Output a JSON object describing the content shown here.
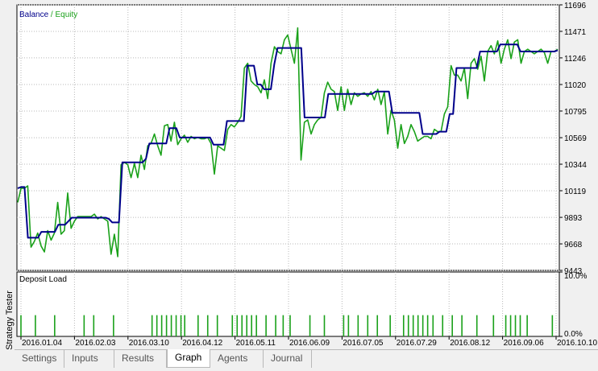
{
  "side_label": "Strategy Tester",
  "tabs": [
    {
      "label": "Settings",
      "active": false
    },
    {
      "label": "Inputs",
      "active": false
    },
    {
      "label": "Results",
      "active": false
    },
    {
      "label": "Graph",
      "active": true
    },
    {
      "label": "Agents",
      "active": false
    },
    {
      "label": "Journal",
      "active": false
    }
  ],
  "colors": {
    "balance": "#00008b",
    "equity": "#1aa11a",
    "load": "#1aa11a",
    "grid": "#b8b8b8",
    "border": "#000000"
  },
  "chart_data": [
    {
      "type": "line",
      "legend": {
        "balance": "Balance",
        "separator": " / ",
        "equity": "Equity",
        "placement": "top-left"
      },
      "x_tick_labels": [
        "2016.01.04",
        "2016.02.03",
        "2016.03.10",
        "2016.04.12",
        "2016.05.11",
        "2016.06.09",
        "2016.07.05",
        "2016.07.29",
        "2016.08.12",
        "2016.09.06",
        "2016.10.10"
      ],
      "y_tick_labels": [
        "11696",
        "11471",
        "11246",
        "11020",
        "10795",
        "10569",
        "10344",
        "10119",
        "9893",
        "9668",
        "9443"
      ],
      "ylim": [
        9443,
        11696
      ],
      "grid": true,
      "series": [
        {
          "name": "Balance",
          "values": [
            10140,
            10150,
            10150,
            9720,
            9720,
            9720,
            9720,
            9770,
            9770,
            9770,
            9770,
            9770,
            9830,
            9830,
            9830,
            9860,
            9890,
            9890,
            9890,
            9890,
            9890,
            9890,
            9890,
            9890,
            9890,
            9890,
            9890,
            9880,
            9850,
            9850,
            9850,
            10360,
            10360,
            10360,
            10360,
            10360,
            10360,
            10360,
            10390,
            10520,
            10520,
            10520,
            10520,
            10520,
            10520,
            10650,
            10650,
            10650,
            10570,
            10570,
            10570,
            10570,
            10570,
            10570,
            10570,
            10570,
            10570,
            10570,
            10510,
            10510,
            10510,
            10510,
            10710,
            10710,
            10710,
            10710,
            10710,
            10710,
            11180,
            11180,
            11180,
            11020,
            11020,
            10980,
            10980,
            10980,
            11190,
            11330,
            11330,
            11330,
            11330,
            11330,
            11330,
            11330,
            11330,
            10740,
            10740,
            10740,
            10740,
            10740,
            10740,
            10740,
            10940,
            10940,
            10940,
            10940,
            10940,
            10940,
            10940,
            10940,
            10940,
            10940,
            10940,
            10940,
            10940,
            10940,
            10960,
            10960,
            10960,
            10960,
            10960,
            10780,
            10780,
            10780,
            10780,
            10780,
            10780,
            10780,
            10780,
            10780,
            10600,
            10600,
            10600,
            10600,
            10600,
            10620,
            10620,
            10620,
            10770,
            10770,
            11160,
            11160,
            11160,
            11160,
            11160,
            11160,
            11160,
            11300,
            11300,
            11300,
            11300,
            11300,
            11300,
            11360,
            11360,
            11360,
            11360,
            11360,
            11360,
            11300,
            11300,
            11300,
            11300,
            11300,
            11300,
            11300,
            11300,
            11300,
            11300,
            11300,
            11310
          ]
        },
        {
          "name": "Equity",
          "values": [
            10020,
            10140,
            10140,
            10160,
            9640,
            9690,
            9760,
            9650,
            9600,
            9780,
            9700,
            9760,
            10020,
            9750,
            9780,
            10100,
            9800,
            9860,
            9900,
            9900,
            9900,
            9900,
            9900,
            9920,
            9880,
            9900,
            9880,
            9860,
            9580,
            9750,
            9560,
            10340,
            10360,
            10340,
            10230,
            10350,
            10230,
            10420,
            10300,
            10500,
            10520,
            10600,
            10500,
            10420,
            10670,
            10680,
            10540,
            10700,
            10510,
            10560,
            10590,
            10530,
            10580,
            10560,
            10570,
            10560,
            10560,
            10570,
            10520,
            10260,
            10500,
            10480,
            10460,
            10640,
            10680,
            10660,
            10700,
            10750,
            11160,
            11200,
            11050,
            11020,
            11000,
            10950,
            11060,
            10900,
            11200,
            11340,
            11300,
            11280,
            11400,
            11440,
            11320,
            11200,
            11500,
            10380,
            10700,
            10720,
            10600,
            10680,
            10720,
            10740,
            10950,
            11040,
            10980,
            10960,
            10800,
            11000,
            10800,
            10980,
            10850,
            10950,
            10920,
            10940,
            10950,
            10920,
            10960,
            10890,
            10980,
            10850,
            10960,
            10600,
            10800,
            10720,
            10480,
            10680,
            10520,
            10580,
            10680,
            10620,
            10540,
            10560,
            10580,
            10580,
            10560,
            10640,
            10620,
            10620,
            10770,
            10830,
            11180,
            11100,
            11100,
            11050,
            11160,
            10900,
            11200,
            11240,
            11150,
            11260,
            11050,
            11300,
            11350,
            11280,
            11390,
            11200,
            11320,
            11400,
            11240,
            11380,
            11400,
            11200,
            11300,
            11320,
            11300,
            11280,
            11300,
            11320,
            11290,
            11200,
            11300,
            11300,
            11320
          ]
        }
      ]
    },
    {
      "type": "bar",
      "title": "Deposit Load",
      "y_tick_labels": [
        "10.0%",
        "0.0%"
      ],
      "ylim": [
        0,
        10
      ],
      "x_tick_labels": [
        "2016.01.04",
        "2016.02.03",
        "2016.03.10",
        "2016.04.12",
        "2016.05.11",
        "2016.06.09",
        "2016.07.05",
        "2016.07.29",
        "2016.08.12",
        "2016.09.06",
        "2016.10.10"
      ],
      "bar_x_fraction": [
        0.0,
        0.027,
        0.063,
        0.118,
        0.136,
        0.173,
        0.245,
        0.254,
        0.263,
        0.272,
        0.281,
        0.29,
        0.299,
        0.306,
        0.331,
        0.349,
        0.367,
        0.395,
        0.404,
        0.413,
        0.422,
        0.431,
        0.44,
        0.458,
        0.476,
        0.49,
        0.503,
        0.54,
        0.567,
        0.603,
        0.612,
        0.63,
        0.648,
        0.666,
        0.69,
        0.715,
        0.724,
        0.733,
        0.742,
        0.751,
        0.76,
        0.77,
        0.788,
        0.806,
        0.824,
        0.852,
        0.883,
        0.906,
        0.915,
        0.924,
        0.933,
        0.946,
        0.993
      ],
      "values": [
        3.3,
        3.3,
        3.3,
        3.3,
        3.3,
        3.3,
        3.3,
        3.3,
        3.3,
        3.3,
        3.3,
        3.3,
        3.3,
        3.3,
        3.3,
        3.3,
        3.3,
        3.3,
        3.3,
        3.3,
        3.3,
        3.3,
        3.3,
        3.3,
        3.3,
        3.3,
        3.3,
        3.3,
        3.3,
        3.3,
        3.3,
        3.3,
        3.3,
        3.3,
        3.3,
        3.3,
        3.3,
        3.3,
        3.3,
        3.3,
        3.3,
        3.3,
        3.3,
        3.3,
        3.3,
        3.3,
        3.3,
        3.3,
        3.3,
        3.3,
        3.3,
        3.3,
        3.3
      ]
    }
  ]
}
